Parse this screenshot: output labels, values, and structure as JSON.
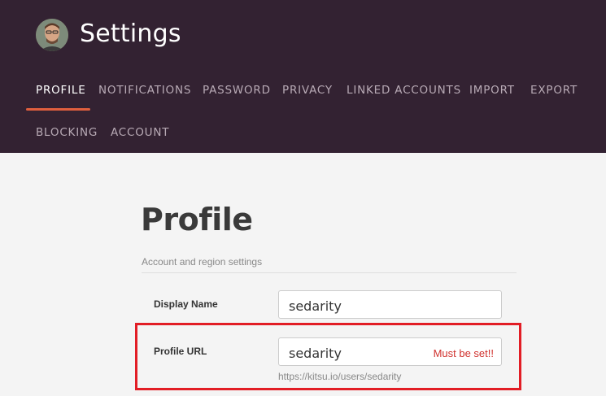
{
  "header": {
    "title": "Settings",
    "avatar_icon": "user-avatar",
    "tabs": [
      {
        "label": "PROFILE",
        "active": true
      },
      {
        "label": "NOTIFICATIONS"
      },
      {
        "label": "PASSWORD"
      },
      {
        "label": "PRIVACY"
      },
      {
        "label": "LINKED ACCOUNTS"
      },
      {
        "label": "IMPORT"
      },
      {
        "label": "EXPORT"
      },
      {
        "label": "BLOCKING"
      },
      {
        "label": "ACCOUNT"
      }
    ]
  },
  "main": {
    "title": "Profile",
    "subtitle": "Account and region settings",
    "fields": {
      "display_name": {
        "label": "Display Name",
        "value": "sedarity"
      },
      "profile_url": {
        "label": "Profile URL",
        "value": "sedarity",
        "error": "Must be set!!",
        "hint": "https://kitsu.io/users/sedarity"
      }
    }
  },
  "colors": {
    "header_bg": "#332232",
    "accent": "#e05f3e",
    "error": "#d0312d",
    "highlight": "#e21d25"
  }
}
